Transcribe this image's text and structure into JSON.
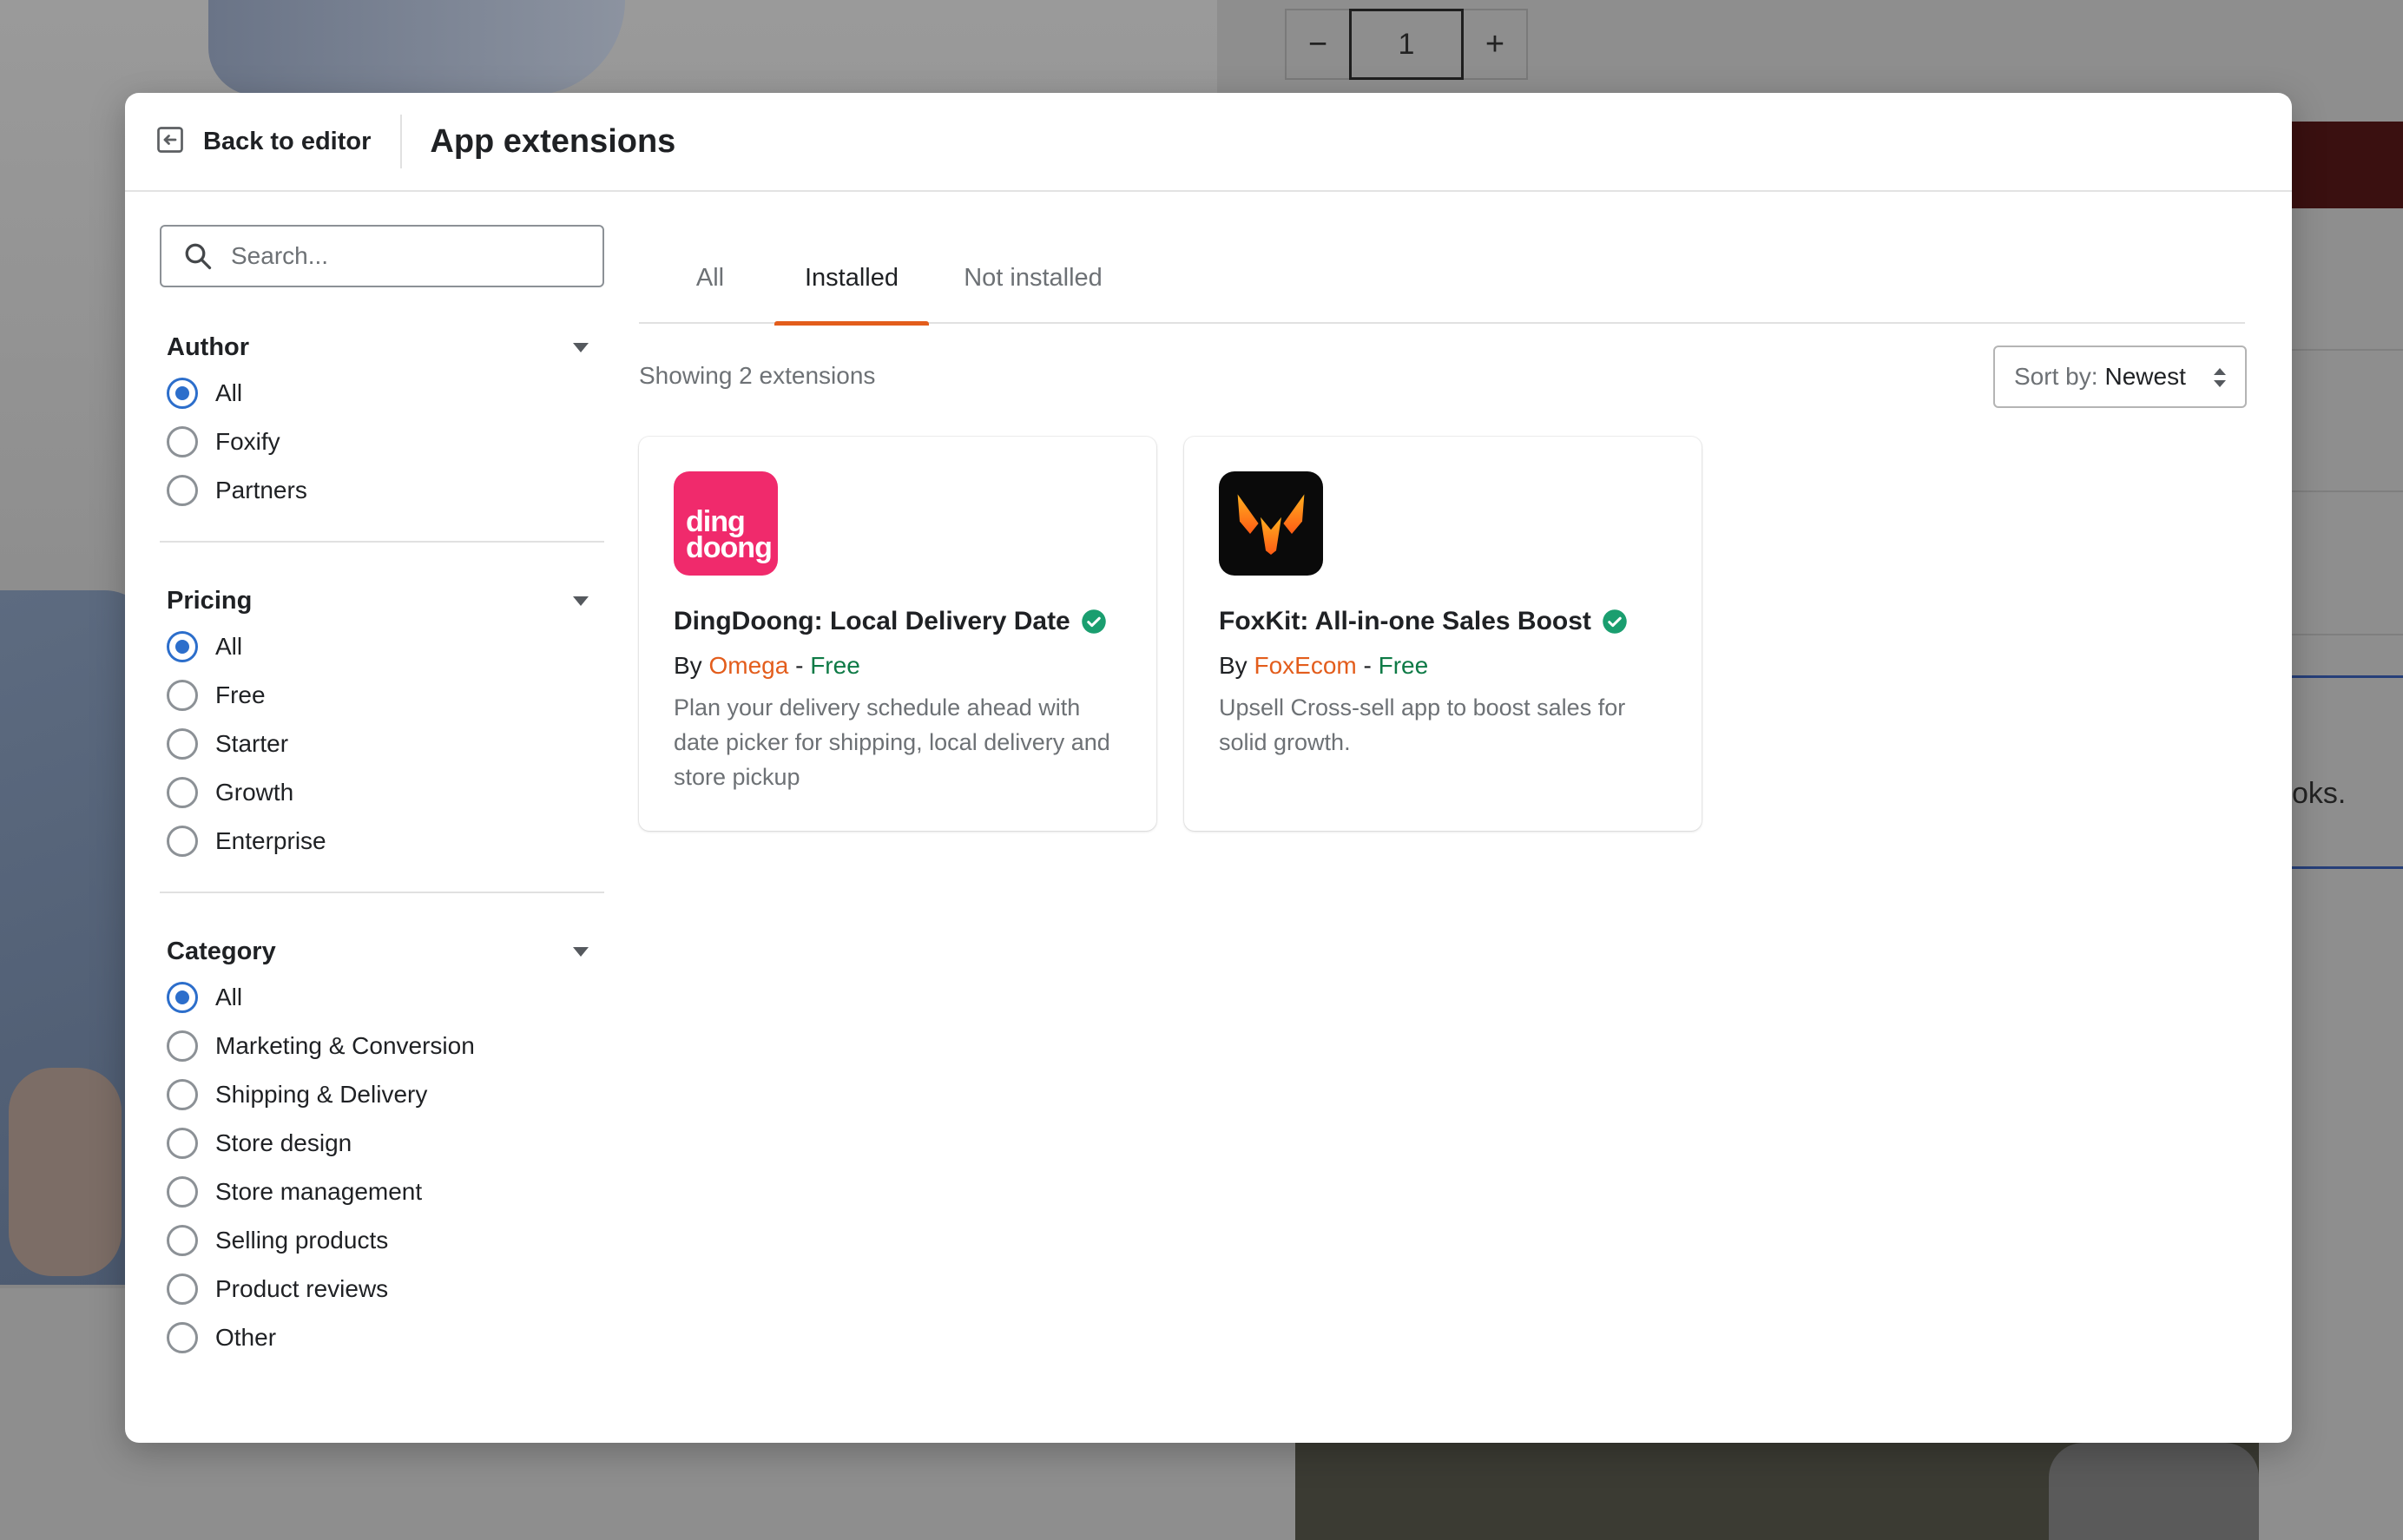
{
  "background": {
    "quantity": {
      "minus": "−",
      "value": "1",
      "plus": "+"
    },
    "partial_text": "oks."
  },
  "header": {
    "back_label": "Back to editor",
    "title": "App extensions"
  },
  "search": {
    "placeholder": "Search..."
  },
  "filters": {
    "author": {
      "title": "Author",
      "options": [
        {
          "label": "All",
          "selected": true
        },
        {
          "label": "Foxify",
          "selected": false
        },
        {
          "label": "Partners",
          "selected": false
        }
      ]
    },
    "pricing": {
      "title": "Pricing",
      "options": [
        {
          "label": "All",
          "selected": true
        },
        {
          "label": "Free",
          "selected": false
        },
        {
          "label": "Starter",
          "selected": false
        },
        {
          "label": "Growth",
          "selected": false
        },
        {
          "label": "Enterprise",
          "selected": false
        }
      ]
    },
    "category": {
      "title": "Category",
      "options": [
        {
          "label": "All",
          "selected": true
        },
        {
          "label": "Marketing & Conversion",
          "selected": false
        },
        {
          "label": "Shipping & Delivery",
          "selected": false
        },
        {
          "label": "Store design",
          "selected": false
        },
        {
          "label": "Store management",
          "selected": false
        },
        {
          "label": "Selling products",
          "selected": false
        },
        {
          "label": "Product reviews",
          "selected": false
        },
        {
          "label": "Other",
          "selected": false
        }
      ]
    }
  },
  "tabs": [
    {
      "label": "All",
      "active": false
    },
    {
      "label": "Installed",
      "active": true
    },
    {
      "label": "Not installed",
      "active": false
    }
  ],
  "results": {
    "showing_text": "Showing 2 extensions",
    "sort_label": "Sort by:",
    "sort_value": "Newest"
  },
  "extensions": [
    {
      "logo_text_1": "ding",
      "logo_text_2": "doong",
      "name": "DingDoong: Local Delivery Date",
      "by": "By",
      "author": "Omega",
      "sep": " - ",
      "price": "Free",
      "description": "Plan your delivery schedule ahead with date picker for shipping, local delivery and store pickup",
      "verified_icon": "verified-check-icon",
      "logo_color": "#f02a6c"
    },
    {
      "name": "FoxKit: All-in-one Sales Boost",
      "by": "By",
      "author": "FoxEcom",
      "sep": " - ",
      "price": "Free",
      "description": "Upsell Cross-sell app to boost sales for solid growth.",
      "verified_icon": "verified-check-icon",
      "logo_color": "#0a0a0a"
    }
  ],
  "colors": {
    "accent": "#e35d1c",
    "radio_selected": "#2c6ecb",
    "verified": "#1a9e6f",
    "price_free": "#0e7a46"
  }
}
